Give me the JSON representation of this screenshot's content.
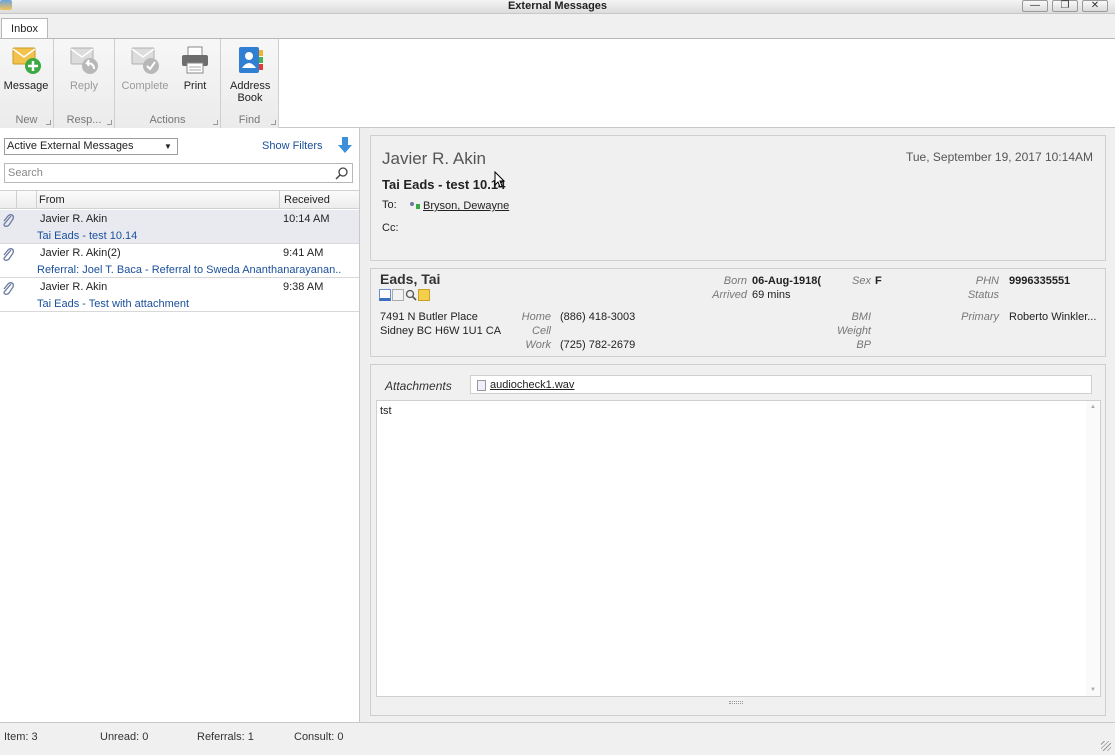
{
  "window": {
    "title": "External Messages",
    "buttons": [
      "—",
      "❐",
      "✕"
    ]
  },
  "ribbon": {
    "tab": "Inbox",
    "groups": {
      "new": {
        "label": "New",
        "message": "Message"
      },
      "respond": {
        "label": "Resp...",
        "reply": "Reply"
      },
      "actions": {
        "label": "Actions",
        "complete": "Complete",
        "print": "Print"
      },
      "find": {
        "label": "Find",
        "address_book": "Address Book"
      }
    }
  },
  "list": {
    "filter": "Active External Messages",
    "show_filters": "Show Filters",
    "search_placeholder": "Search",
    "columns": {
      "from": "From",
      "received": "Received"
    },
    "rows": [
      {
        "from": "Javier R. Akin",
        "time": "10:14 AM",
        "subject": "Tai Eads - test 10.14"
      },
      {
        "from": "Javier R. Akin(2)",
        "time": "9:41 AM",
        "subject": "Referral: Joel T. Baca - Referral to Sweda Ananthanarayanan..."
      },
      {
        "from": "Javier R. Akin",
        "time": "9:38 AM",
        "subject": "Tai Eads - Test with attachment"
      }
    ]
  },
  "message": {
    "sender": "Javier R. Akin",
    "date": "Tue, September 19, 2017 10:14AM",
    "subject": "Tai Eads - test 10.14",
    "to_label": "To:",
    "to": "Bryson, Dewayne",
    "cc_label": "Cc:",
    "attachments_label": "Attachments",
    "attachment": "audiocheck1.wav",
    "body": "tst"
  },
  "patient": {
    "name": "Eads, Tai",
    "born_label": "Born",
    "born": "06-Aug-1918(",
    "arrived_label": "Arrived",
    "arrived": "69 mins",
    "sex_label": "Sex",
    "sex": "F",
    "phn_label": "PHN",
    "phn": "9996335551",
    "status_label": "Status",
    "address1": "7491 N Butler Place",
    "address2": "Sidney BC  H6W 1U1  CA",
    "home_label": "Home",
    "home": "(886) 418-3003",
    "cell_label": "Cell",
    "work_label": "Work",
    "work": "(725) 782-2679",
    "bmi_label": "BMI",
    "weight_label": "Weight",
    "bp_label": "BP",
    "primary_label": "Primary",
    "primary": "Roberto Winkler..."
  },
  "status": {
    "item": "Item: 3",
    "unread": "Unread: 0",
    "referrals": "Referrals: 1",
    "consult": "Consult: 0"
  },
  "colors": {
    "link": "#1a4f9c",
    "accent": "#3d8fdc"
  }
}
